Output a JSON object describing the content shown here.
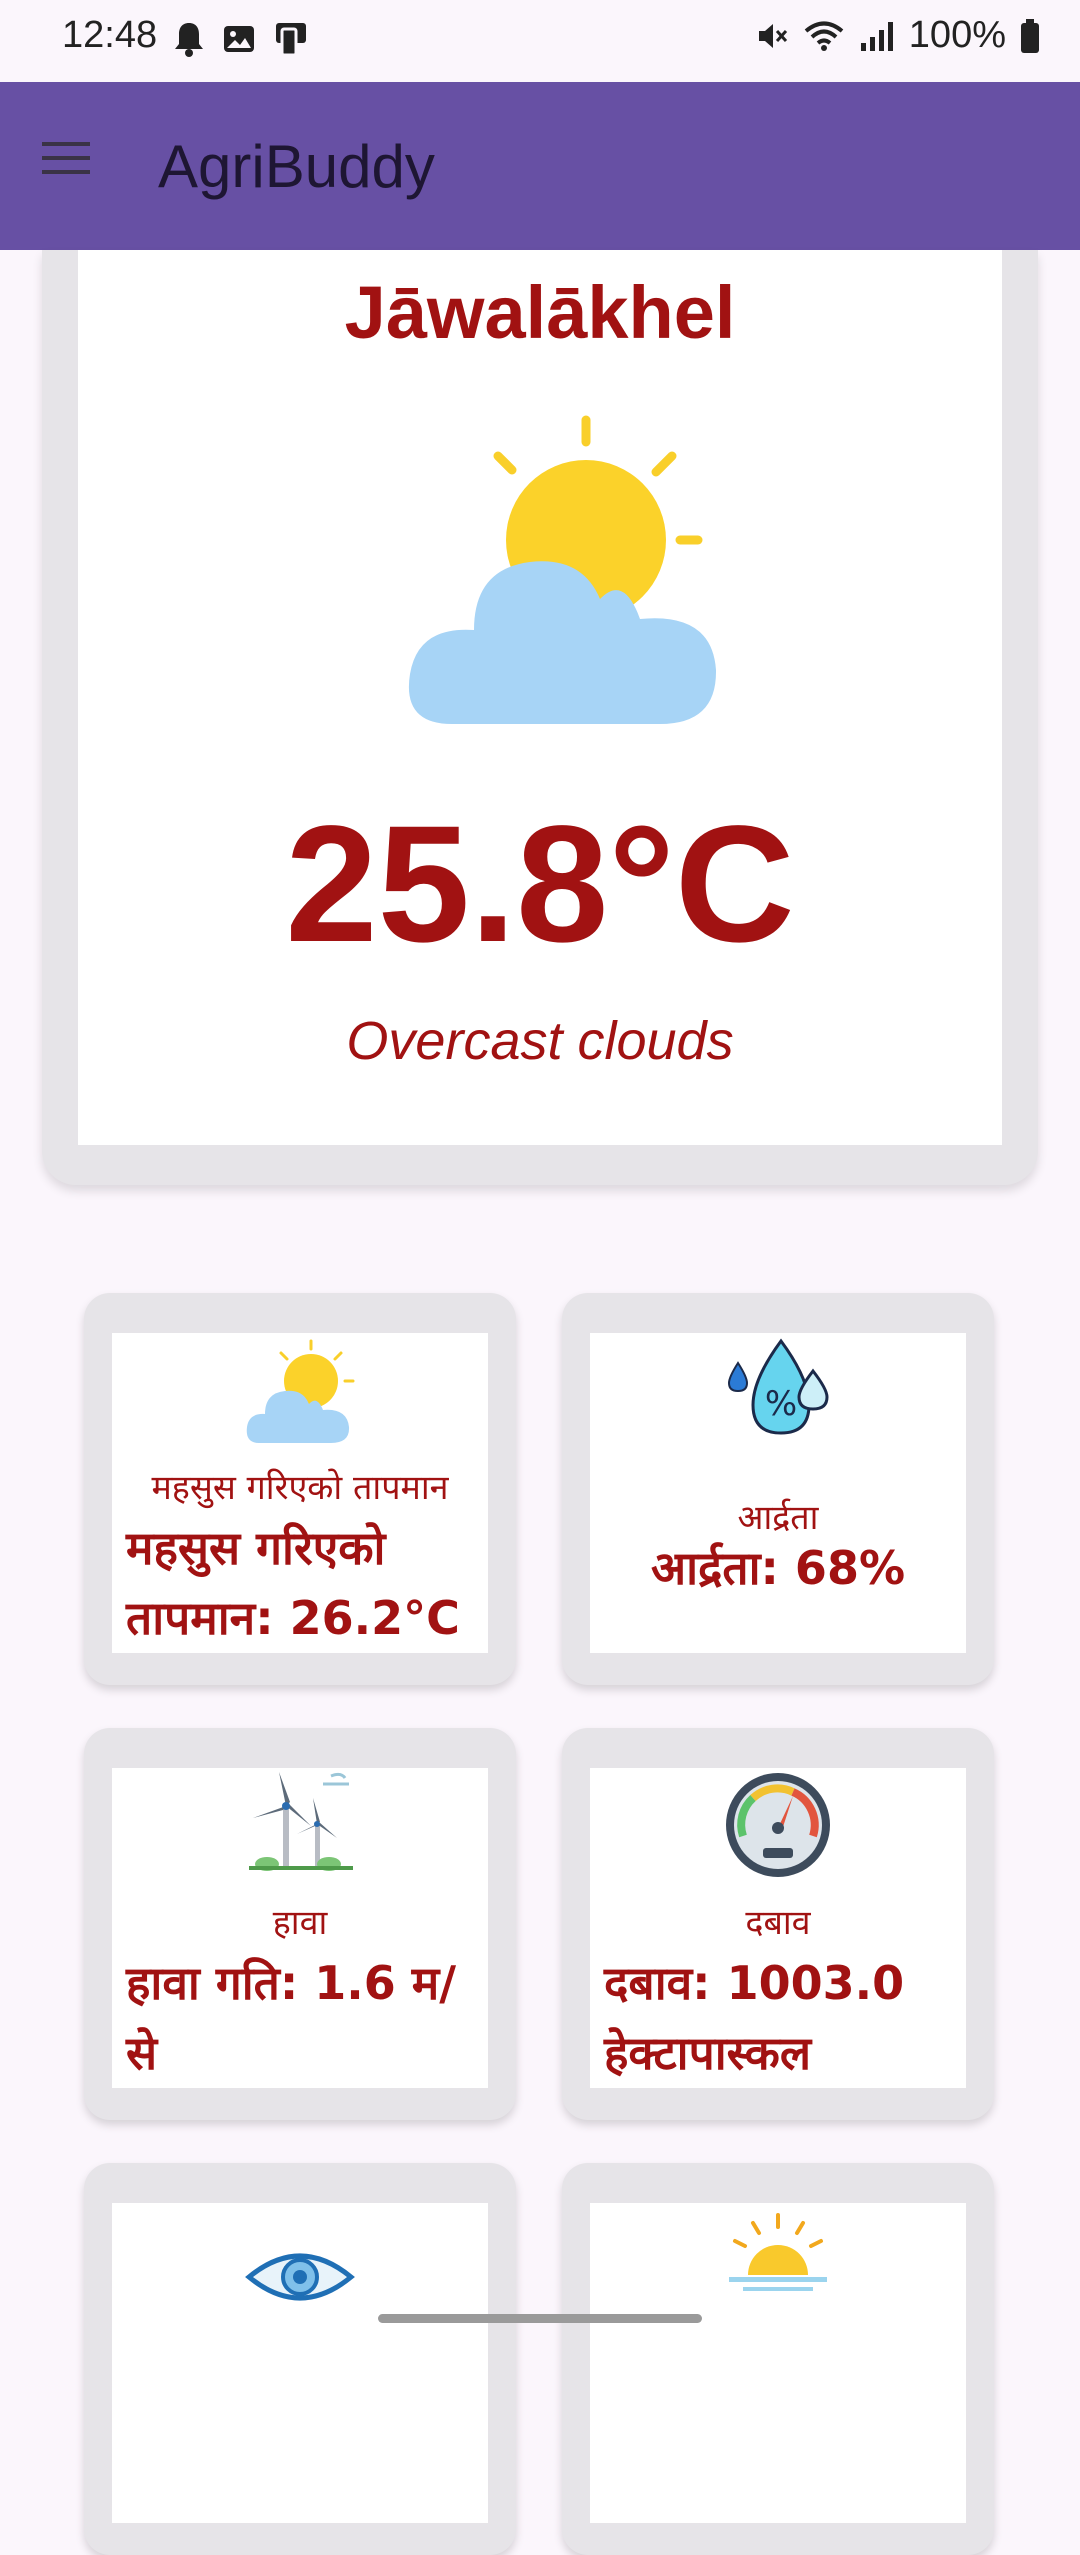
{
  "status_bar": {
    "time": "12:48",
    "battery": "100%",
    "left_icons": [
      "notification-bell-icon",
      "image-icon",
      "phone-icon"
    ],
    "right_icons": [
      "mute-icon",
      "wifi-icon",
      "signal-icon",
      "battery-icon"
    ]
  },
  "app_bar": {
    "title": "AgriBuddy",
    "menu_icon": "hamburger-menu-icon",
    "background": "#6750A4"
  },
  "weather": {
    "location": "Jāwalākhel",
    "temperature": "25.8°C",
    "condition": "Overcast clouds",
    "icon": "partly-cloudy-icon",
    "accent_color": "#A11212"
  },
  "tiles": [
    {
      "icon": "partly-cloudy-icon",
      "label": "महसुस गरिएको तापमान",
      "value": "महसुस गरिएको तापमान: 26.2°C"
    },
    {
      "icon": "humidity-icon",
      "label": "आर्द्रता",
      "value": "आर्द्रता: 68%"
    },
    {
      "icon": "wind-turbine-icon",
      "label": "हावा",
      "value": "हावा गति: 1.6 म/से"
    },
    {
      "icon": "pressure-gauge-icon",
      "label": "दबाव",
      "value": "दबाव: 1003.0 हेक्टापास्कल"
    },
    {
      "icon": "eye-icon"
    },
    {
      "icon": "sunrise-icon"
    }
  ]
}
